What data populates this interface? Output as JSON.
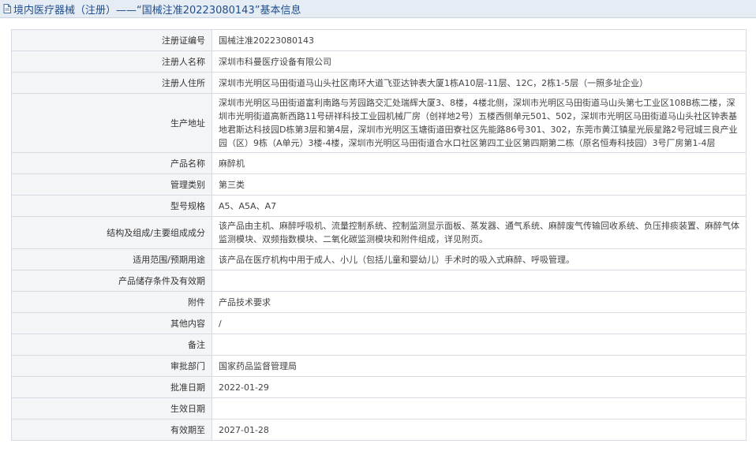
{
  "header": {
    "icon": "document-icon",
    "title": "境内医疗器械（注册）——“国械注准20223080143”基本信息"
  },
  "rows": [
    {
      "label": "注册证编号",
      "value": "国械注准20223080143"
    },
    {
      "label": "注册人名称",
      "value": "深圳市科曼医疗设备有限公司"
    },
    {
      "label": "注册人住所",
      "value": "深圳市光明区马田街道马山头社区南环大道飞亚达钟表大厦1栋A10层-11层、12C，2栋1-5层（一照多址企业）"
    },
    {
      "label": "生产地址",
      "value": "深圳市光明区马田街道富利南路与芳园路交汇处瑞辉大厦3、8楼，4楼北侧，深圳市光明区马田街道马山头第七工业区108B栋二楼，深圳市光明街道高新西路11号研祥科技工业园机械厂房（创祥地2号）五楼西侧单元501、502，深圳市光明区马田街道马山头社区钟表基地君斯达科技园D栋第3层和第4层，深圳市光明区玉塘街道田寮社区先能路86号301、302，东莞市黄江镇星光辰星路2号冠城三良产业园（区）9栋（A单元）3楼-4楼，深圳市光明区马田街道合水口社区第四工业区第四期第二栋（原名恒寿科技园）3号厂房第1-4层"
    },
    {
      "label": "产品名称",
      "value": "麻醉机"
    },
    {
      "label": "管理类别",
      "value": "第三类"
    },
    {
      "label": "型号规格",
      "value": "A5、A5A、A7"
    },
    {
      "label": "结构及组成/主要组成成分",
      "value": "该产品由主机、麻醉呼吸机、流量控制系统、控制监测显示面板、蒸发器、通气系统、麻醉废气传输回收系统、负压排痰装置、麻醉气体监测模块、双频指数模块、二氧化碳监测模块和附件组成，详见附页。"
    },
    {
      "label": "适用范围/预期用途",
      "value": "该产品在医疗机构中用于成人、小儿（包括儿童和婴幼儿）手术时的吸入式麻醉、呼吸管理。"
    },
    {
      "label": "产品储存条件及有效期",
      "value": ""
    },
    {
      "label": "附件",
      "value": "产品技术要求"
    },
    {
      "label": "其他内容",
      "value": "/"
    },
    {
      "label": "备注",
      "value": ""
    },
    {
      "label": "审批部门",
      "value": "国家药品监督管理局"
    },
    {
      "label": "批准日期",
      "value": "2022-01-29"
    },
    {
      "label": "生效日期",
      "value": ""
    },
    {
      "label": "有效期至",
      "value": "2027-01-28"
    }
  ]
}
